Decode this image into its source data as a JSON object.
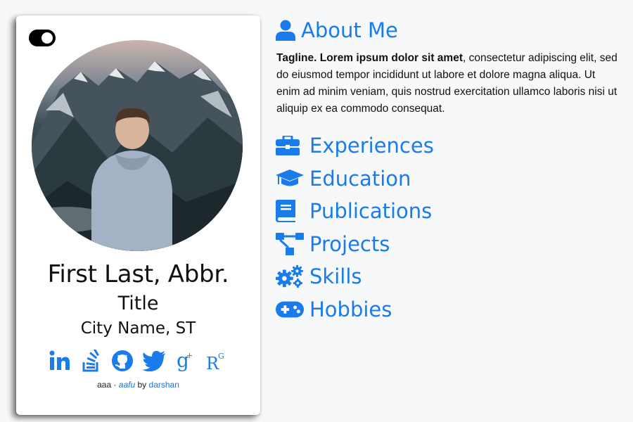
{
  "profile": {
    "name": "First Last, Abbr.",
    "title": "Title",
    "location": "City Name, ST",
    "photo_alt": "person-looking-at-mountains-photo"
  },
  "theme_toggle": {
    "state": "dark"
  },
  "socials": [
    {
      "icon": "linkedin-icon"
    },
    {
      "icon": "stackoverflow-icon"
    },
    {
      "icon": "github-icon"
    },
    {
      "icon": "twitter-icon"
    },
    {
      "icon": "google-scholar-icon"
    },
    {
      "icon": "researchgate-icon"
    }
  ],
  "footer": {
    "prefix": "aaa ·",
    "theme_link": "aafu",
    "by": "by",
    "author_link": "darshan"
  },
  "about": {
    "heading": "About Me",
    "tagline": "Tagline. Lorem ipsum dolor sit amet",
    "body": ", consectetur adipiscing elit, sed do eiusmod tempor incididunt ut labore et dolore magna aliqua. Ut enim ad minim veniam, quis nostrud exercitation ullamco laboris nisi ut aliquip ex ea commodo consequat."
  },
  "sections": [
    {
      "label": "Experiences",
      "icon": "briefcase-icon"
    },
    {
      "label": "Education",
      "icon": "graduation-cap-icon"
    },
    {
      "label": "Publications",
      "icon": "book-icon"
    },
    {
      "label": "Projects",
      "icon": "project-diagram-icon"
    },
    {
      "label": "Skills",
      "icon": "gears-icon"
    },
    {
      "label": "Hobbies",
      "icon": "gamepad-icon"
    }
  ],
  "colors": {
    "accent": "#1a7bea",
    "background": "#f7f8fa",
    "card": "#ffffff"
  }
}
